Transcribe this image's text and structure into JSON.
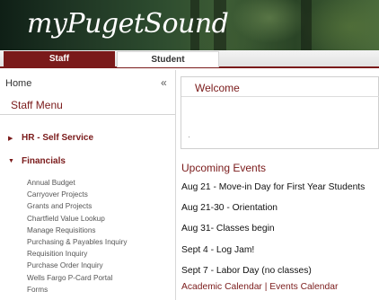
{
  "banner": {
    "logo_text": "myPugetSound"
  },
  "tabs": [
    {
      "label": "Staff",
      "active": true
    },
    {
      "label": "Student",
      "active": false
    }
  ],
  "sidebar": {
    "home_label": "Home",
    "collapse_icon": "«",
    "menu_title": "Staff Menu",
    "sections": [
      {
        "label": "HR - Self Service",
        "expanded": false,
        "icon": "caret-right-icon"
      },
      {
        "label": "Financials",
        "expanded": true,
        "icon": "caret-down-icon"
      }
    ],
    "financial_items": [
      "Annual Budget",
      "Carryover Projects",
      "Grants and Projects",
      "Chartfield Value Lookup",
      "Manage Requisitions",
      "Purchasing & Payables Inquiry",
      "Requisition Inquiry",
      "Purchase Order Inquiry",
      "Wells Fargo P-Card Portal",
      "Forms"
    ]
  },
  "main": {
    "welcome_title": "Welcome",
    "events_title": "Upcoming Events",
    "events": [
      "Aug 21 - Move-in Day for First Year Students",
      "Aug 21-30 - Orientation",
      "Aug 31- Classes begin",
      "Sept 4 - Log Jam!",
      "Sept 7 - Labor Day (no classes)"
    ],
    "links": {
      "academic_calendar": "Academic Calendar",
      "separator": " | ",
      "events_calendar": "Events Calendar"
    }
  },
  "colors": {
    "accent": "#7a1a1a",
    "tab_active_bg": "#7a1a1a",
    "text": "#111111"
  }
}
